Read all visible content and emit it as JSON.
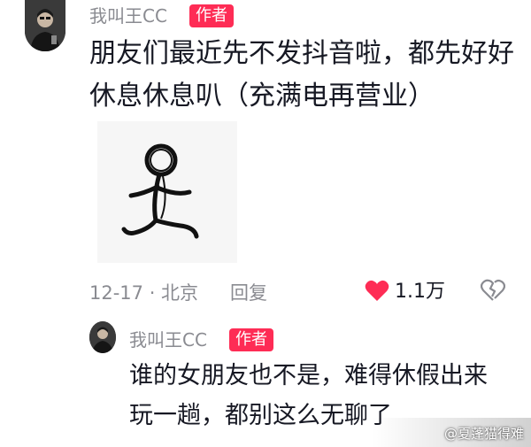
{
  "comment": {
    "username": "我叫王CC",
    "author_badge": "作者",
    "text_lines": [
      "朋友们最近先不发抖音啦，都先好好",
      "休息休息叭（充满电再营业）"
    ],
    "meta": "12-17 · 北京",
    "reply_label": "回复",
    "like_count": "1.1万",
    "sticker_icon": "running-stick-figure"
  },
  "reply": {
    "username": "我叫王CC",
    "author_badge": "作者",
    "text_lines": [
      "谁的女朋友也不是，难得休假出来",
      "玩一趟，都别这么无聊了"
    ]
  },
  "watermark": "@夏蓬猫得难",
  "colors": {
    "accent": "#fe2c55",
    "secondary_text": "#8a8b91",
    "primary_text": "#161823"
  }
}
